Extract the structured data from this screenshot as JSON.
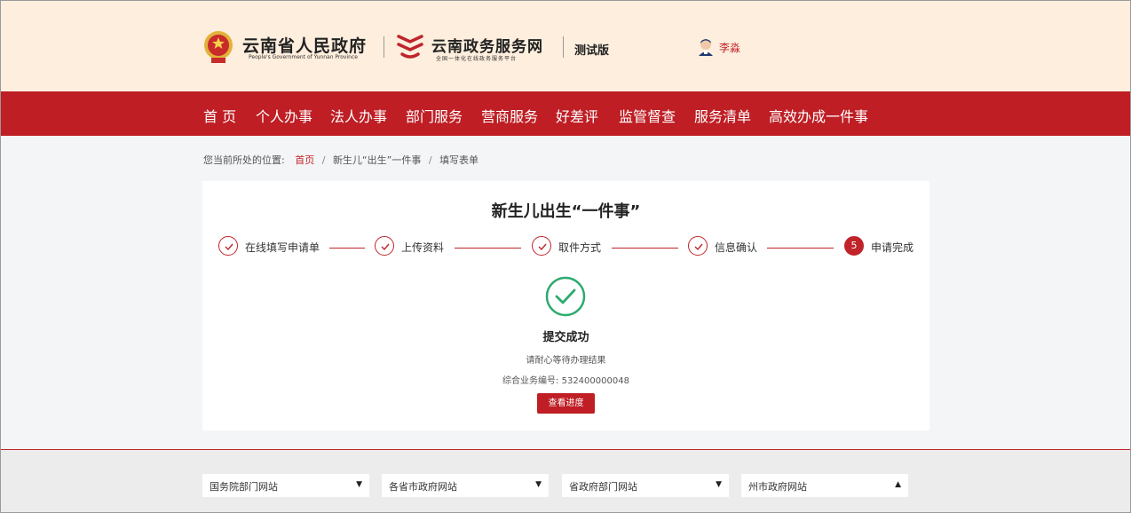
{
  "header": {
    "gov_title": "云南省人民政府",
    "gov_subtitle": "People's Government of Yunnan Province",
    "service_title": "云南政务服务网",
    "service_subtitle": "全国一体化在线政务服务平台",
    "test_badge": "测试版",
    "user_name": "李淼",
    "colors": {
      "header_bg": "#fdeedd",
      "brand_red": "#be1e24"
    }
  },
  "nav": {
    "items": [
      {
        "label": "首 页"
      },
      {
        "label": "个人办事"
      },
      {
        "label": "法人办事"
      },
      {
        "label": "部门服务"
      },
      {
        "label": "营商服务"
      },
      {
        "label": "好差评"
      },
      {
        "label": "监管督查"
      },
      {
        "label": "服务清单"
      },
      {
        "label": "高效办成一件事"
      }
    ]
  },
  "breadcrumb": {
    "prefix": "您当前所处的位置:",
    "items": [
      "首页",
      "新生儿“出生”一件事",
      "填写表单"
    ],
    "separator": "/"
  },
  "main": {
    "title": "新生儿出生“一件事”",
    "steps": [
      {
        "label": "在线填写申请单",
        "status": "done"
      },
      {
        "label": "上传资料",
        "status": "done"
      },
      {
        "label": "取件方式",
        "status": "done"
      },
      {
        "label": "信息确认",
        "status": "done"
      },
      {
        "label": "申请完成",
        "status": "current",
        "number": "5"
      }
    ],
    "success_title": "提交成功",
    "success_message": "请耐心等待办理结果",
    "business_number": "综合业务编号: 532400000048",
    "progress_button": "查看进度",
    "success_color": "#2eaa6e"
  },
  "footer": {
    "selects": [
      {
        "label": "国务院部门网站",
        "caret": "▼"
      },
      {
        "label": "各省市政府网站",
        "caret": "▼"
      },
      {
        "label": "省政府部门网站",
        "caret": "▼"
      },
      {
        "label": "州市政府网站",
        "caret": "▲"
      }
    ]
  }
}
